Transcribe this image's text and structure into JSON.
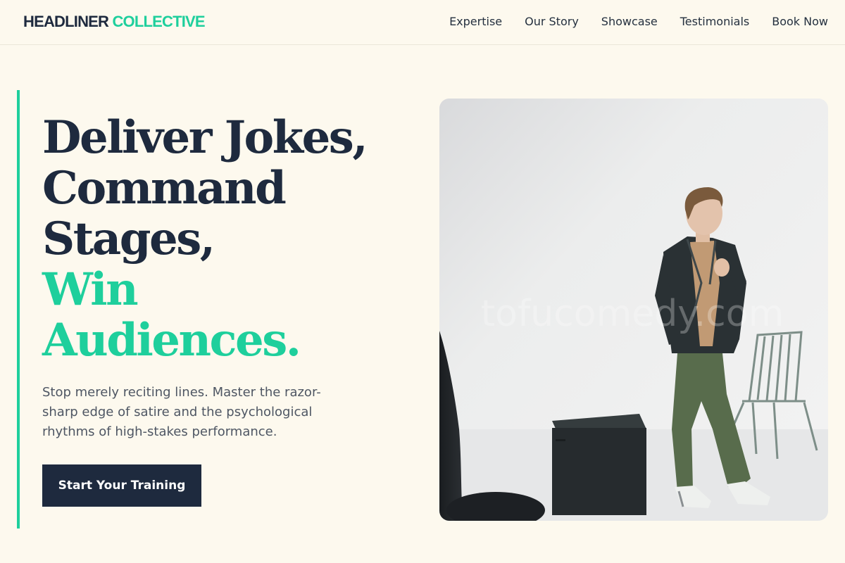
{
  "header": {
    "brand_part1": "HEADLINER",
    "brand_part2": "COLLECTIVE",
    "nav": [
      {
        "label": "Expertise"
      },
      {
        "label": "Our Story"
      },
      {
        "label": "Showcase"
      },
      {
        "label": "Testimonials"
      },
      {
        "label": "Book Now"
      }
    ]
  },
  "hero": {
    "headline_lines": [
      "Deliver Jokes,",
      "Command",
      "Stages,"
    ],
    "headline_accent_lines": [
      "Win",
      "Audiences."
    ],
    "subtext": "Stop merely reciting lines. Master the razor-sharp edge of satire and the psychological rhythms of high-stakes performance.",
    "cta_label": "Start Your Training",
    "image_watermark": "tofucomedy.com"
  },
  "colors": {
    "accent": "#1ecf9c",
    "navy": "#1e2a3e",
    "background": "#fdf9ee"
  }
}
